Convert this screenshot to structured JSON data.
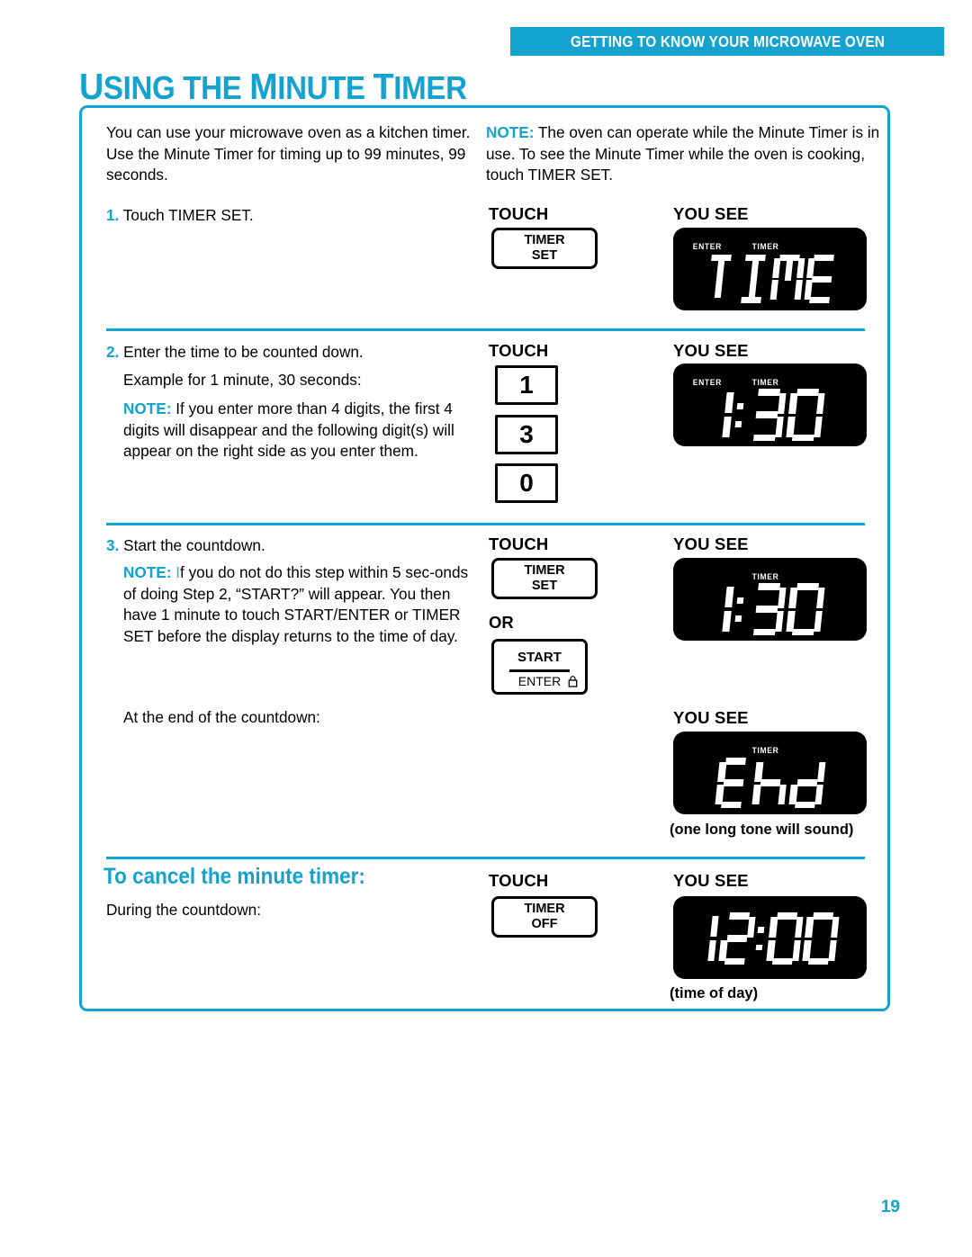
{
  "header": {
    "banner_text": "GETTING TO KNOW YOUR MICROWAVE OVEN",
    "banner_color": "#13A3CE"
  },
  "page_title": {
    "full": "USING THE MINUTE TIMER",
    "parts": [
      "U",
      "SING THE ",
      "M",
      "INUTE ",
      "T",
      "IMER"
    ]
  },
  "intro": {
    "left_paragraph": "You can use your microwave oven as a kitchen timer. Use the Minute Timer for timing up to 99 minutes, 99 seconds.",
    "right_note_label": "NOTE:",
    "right_note_text": " The oven can operate while the Minute Timer is in use. To see the Minute Timer while the oven is cooking, touch TIMER SET."
  },
  "columns": {
    "touch": "TOUCH",
    "you_see": "YOU SEE",
    "or": "OR"
  },
  "steps": [
    {
      "number": "1.",
      "text": " Touch TIMER SET.",
      "touch_keys": [
        {
          "type": "rounded",
          "lines": [
            "TIMER",
            "SET"
          ]
        }
      ],
      "display": {
        "indicators": [
          "ENTER",
          "TIMER"
        ],
        "value": "TIME"
      }
    },
    {
      "number": "2.",
      "text": " Enter the time to be counted down.",
      "subtext": "Example for 1 minute, 30 seconds:",
      "note_label": "NOTE:",
      "note_text": " If you enter more than 4 digits, the first 4 digits will disappear and the following digit(s) will appear on the right side as you enter them.",
      "touch_keys": [
        {
          "type": "numeric",
          "lines": [
            "1"
          ]
        },
        {
          "type": "numeric",
          "lines": [
            "3"
          ]
        },
        {
          "type": "numeric",
          "lines": [
            "0"
          ]
        }
      ],
      "display": {
        "indicators": [
          "ENTER",
          "TIMER"
        ],
        "value": "1:30"
      }
    },
    {
      "number": "3.",
      "text": " Start the countdown.",
      "note_label": "NOTE:",
      "note_text_cyan_i": "I",
      "note_text": "f you do not do this step within 5 sec-onds of doing Step 2, “START?” will appear. You then have 1 minute to touch START/ENTER or TIMER SET before the display returns to the time of day.",
      "touch_keys": [
        {
          "type": "rounded",
          "lines": [
            "TIMER",
            "SET"
          ]
        },
        {
          "type": "start-enter",
          "lines": [
            "START",
            "ENTER"
          ],
          "icon": "lock-icon"
        }
      ],
      "display": {
        "indicators": [
          "TIMER"
        ],
        "value": "1:30"
      }
    }
  ],
  "end_of_countdown": {
    "label": "At the end of the countdown:",
    "you_see": "YOU SEE",
    "display": {
      "indicators": [
        "TIMER"
      ],
      "value": "END"
    },
    "caption": "(one long tone will sound)"
  },
  "cancel_section": {
    "heading": "To cancel the minute timer:",
    "body": "During the countdown:",
    "touch": "TOUCH",
    "you_see": "YOU SEE",
    "touch_keys": [
      {
        "type": "rounded",
        "lines": [
          "TIMER",
          "OFF"
        ]
      }
    ],
    "display": {
      "indicators": [],
      "value": "12:00"
    },
    "caption": "(time of day)"
  },
  "page_number": "19"
}
